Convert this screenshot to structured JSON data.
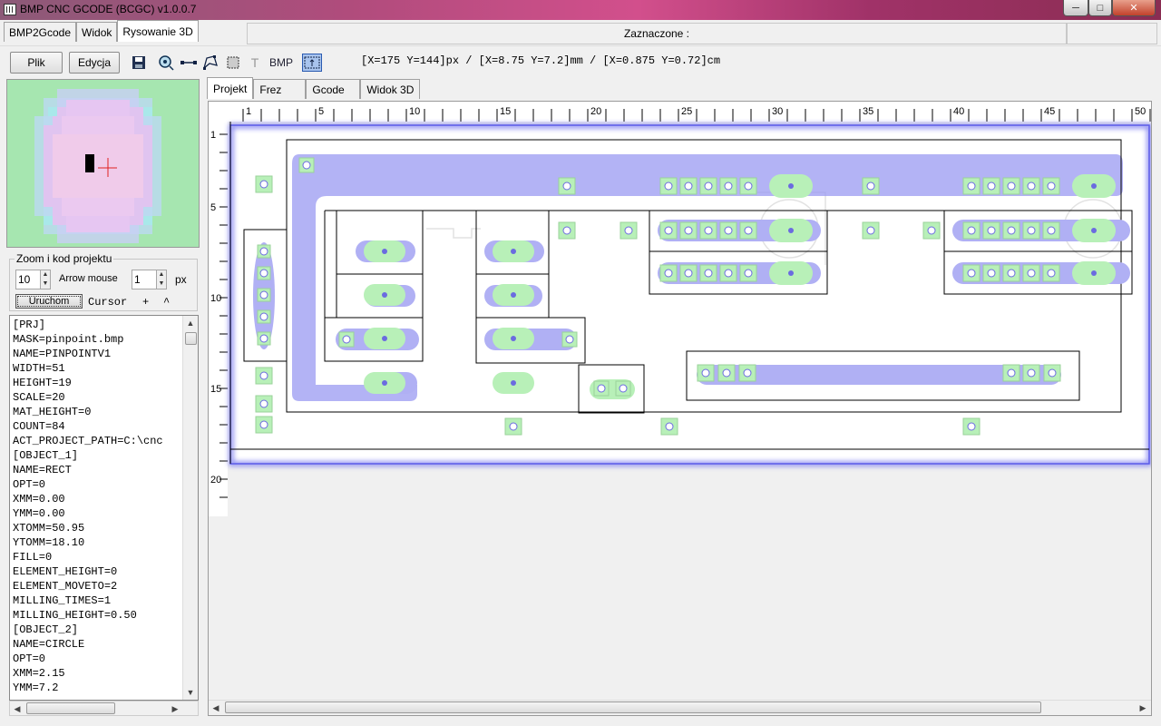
{
  "window": {
    "title": "BMP CNC GCODE (BCGC) v1.0.0.7",
    "minimize": "─",
    "maximize": "□",
    "close": "✕"
  },
  "top_tabs": [
    {
      "label": "BMP2Gcode"
    },
    {
      "label": "Widok"
    },
    {
      "label": "Rysowanie 3D",
      "active": true
    }
  ],
  "selected_label": "Zaznaczone :",
  "toolbar": {
    "file": "Plik",
    "edit": "Edycja",
    "bmp_label": "BMP",
    "text_tool": "T",
    "coords": "[X=175 Y=144]px / [X=8.75 Y=7.2]mm / [X=0.875 Y=0.72]cm",
    "icons": [
      "save-icon",
      "circle-tool-icon",
      "line-tool-icon",
      "polygon-tool-icon",
      "rect-tool-icon",
      "text-tool-icon",
      "bmp-tool-icon"
    ]
  },
  "left_panel": {
    "zoom_group_title": "Zoom i kod projektu",
    "zoom_value": "10",
    "arrow_mouse_label": "Arrow mouse",
    "arrow_mouse_value": "1",
    "px_label": "px",
    "run_button": "Uruchom",
    "cursor_label": "Cursor",
    "plus_label": "+",
    "caret_label": "^"
  },
  "project_text": [
    "[PRJ]",
    "MASK=pinpoint.bmp",
    "NAME=PINPOINTV1",
    "WIDTH=51",
    "HEIGHT=19",
    "SCALE=20",
    "MAT_HEIGHT=0",
    "COUNT=84",
    "ACT_PROJECT_PATH=C:\\cnc",
    "[OBJECT_1]",
    "NAME=RECT",
    "OPT=0",
    "XMM=0.00",
    "YMM=0.00",
    "XTOMM=50.95",
    "YTOMM=18.10",
    "FILL=0",
    "ELEMENT_HEIGHT=0",
    "ELEMENT_MOVETO=2",
    "MILLING_TIMES=1",
    "MILLING_HEIGHT=0.50",
    "[OBJECT_2]",
    "NAME=CIRCLE",
    "OPT=0",
    "XMM=2.15",
    "YMM=7.2"
  ],
  "right_tabs": [
    {
      "label": "Projekt",
      "active": true
    },
    {
      "label": "Frez"
    },
    {
      "label": "Gcode"
    },
    {
      "label": "Widok 3D"
    }
  ],
  "ruler": {
    "x_labels": [
      "1",
      "5",
      "10",
      "15",
      "20",
      "25",
      "30",
      "35",
      "40",
      "45",
      "50"
    ],
    "y_labels": [
      "1",
      "5",
      "10",
      "15",
      "20"
    ]
  },
  "colors": {
    "trace": "#9a9af2",
    "pad": "#b8f0b8",
    "preview_bg": "#a6e6b0",
    "board_border": "#7a7af0"
  }
}
